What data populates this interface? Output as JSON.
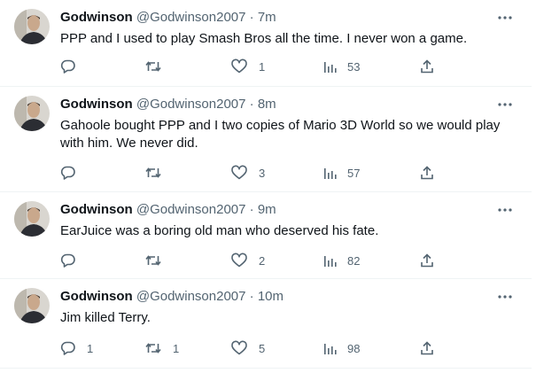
{
  "tweets": [
    {
      "name": "Godwinson",
      "handle": "@Godwinson2007",
      "separator": "·",
      "time": "7m",
      "text": "PPP and I used to play Smash Bros all the time. I never won a game.",
      "replies": "",
      "retweets": "",
      "likes": "1",
      "views": "53"
    },
    {
      "name": "Godwinson",
      "handle": "@Godwinson2007",
      "separator": "·",
      "time": "8m",
      "text": "Gahoole bought PPP and I two copies of Mario 3D World so we would play with him. We never did.",
      "replies": "",
      "retweets": "",
      "likes": "3",
      "views": "57"
    },
    {
      "name": "Godwinson",
      "handle": "@Godwinson2007",
      "separator": "·",
      "time": "9m",
      "text": "EarJuice was a boring old man who deserved his fate.",
      "replies": "",
      "retweets": "",
      "likes": "2",
      "views": "82"
    },
    {
      "name": "Godwinson",
      "handle": "@Godwinson2007",
      "separator": "·",
      "time": "10m",
      "text": "Jim killed Terry.",
      "replies": "1",
      "retweets": "1",
      "likes": "5",
      "views": "98"
    }
  ],
  "icons": {
    "reply": "reply-icon",
    "retweet": "retweet-icon",
    "like": "heart-icon",
    "views": "views-icon",
    "share": "share-icon",
    "more": "more-icon"
  },
  "colors": {
    "text": "#0f1419",
    "secondary": "#536471",
    "divider": "#eff3f4"
  }
}
